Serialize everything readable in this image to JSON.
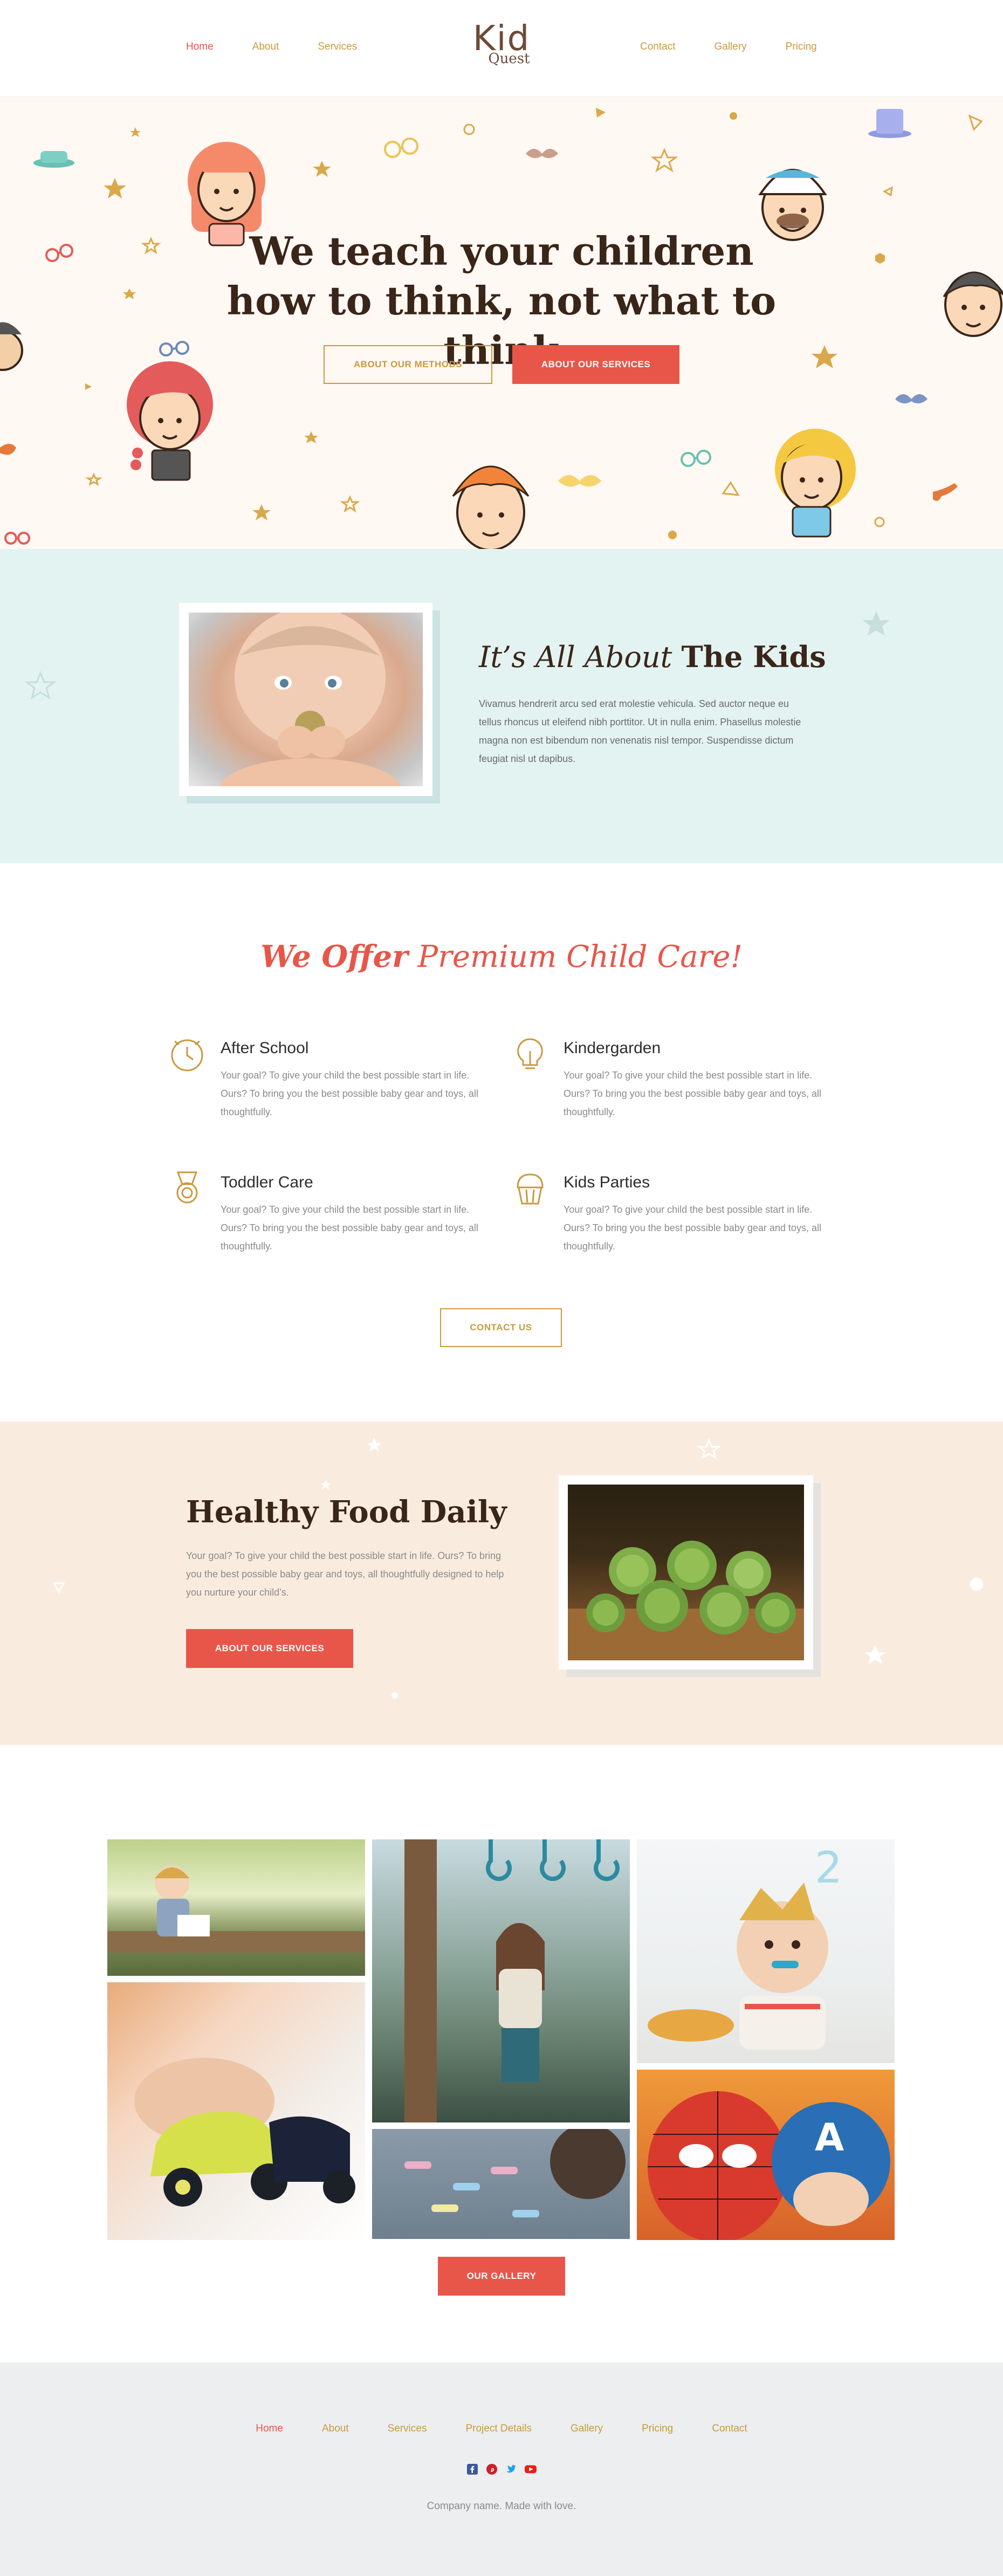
{
  "header": {
    "nav_left": [
      "Home",
      "About",
      "Services"
    ],
    "nav_right": [
      "Contact",
      "Gallery",
      "Pricing"
    ],
    "logo_top": "Kid",
    "logo_bottom": "Quest"
  },
  "hero": {
    "title_part1": "We teach your children ",
    "title_bold1": "how to think",
    "title_part2": ", not what to think",
    "btn_methods": "ABOUT OUR METHODS",
    "btn_services": "ABOUT OUR SERVICES"
  },
  "about": {
    "title_italic": "It’s All About ",
    "title_bold": "The Kids",
    "text": "Vivamus hendrerit arcu sed erat molestie vehicula. Sed auctor neque eu tellus rhoncus ut eleifend nibh porttitor. Ut in nulla enim. Phasellus molestie magna non est bibendum non venenatis nisl tempor. Suspendisse dictum feugiat nisl ut dapibus."
  },
  "services": {
    "title_bold": "We Offer",
    "title_italic": " Premium Child Care!",
    "items": [
      {
        "title": "After School",
        "text": "Your goal? To give your child the best possible start in life. Ours? To bring you the best possible baby gear and toys, all thoughtfully.",
        "icon": "clock-icon"
      },
      {
        "title": "Kindergarden",
        "text": "Your goal? To give your child the best possible start in life. Ours? To bring you the best possible baby gear and toys, all thoughtfully.",
        "icon": "bulb-icon"
      },
      {
        "title": "Toddler Care",
        "text": "Your goal? To give your child the best possible start in life. Ours? To bring you the best possible baby gear and toys, all thoughtfully.",
        "icon": "medal-icon"
      },
      {
        "title": "Kids Parties",
        "text": "Your goal? To give your child the best possible start in life. Ours? To bring you the best possible baby gear and toys, all thoughtfully.",
        "icon": "cupcake-icon"
      }
    ],
    "contact_btn": "CONTACT US"
  },
  "food": {
    "title_bold": "Healthy Food",
    "title_normal": " Daily",
    "text": "Your goal? To give your child the best possible start in life. Ours? To bring you the best possible baby gear and toys, all thoughtfully designed to help you nurture your child’s.",
    "btn": "ABOUT OUR SERVICES"
  },
  "gallery": {
    "btn": "OUR GALLERY"
  },
  "footer": {
    "nav": [
      "Home",
      "About",
      "Services",
      "Project Details",
      "Gallery",
      "Pricing",
      "Contact"
    ],
    "social": [
      "facebook-icon",
      "pinterest-icon",
      "twitter-icon",
      "youtube-icon"
    ],
    "copyright": "Company name. Made with love."
  },
  "colors": {
    "accent": "#e8564a",
    "gold": "#c9993f",
    "hero_bg": "#fff8f3",
    "about_bg": "#e3f3f2",
    "food_bg": "#f9ecdf",
    "footer_bg": "#eceef0"
  }
}
